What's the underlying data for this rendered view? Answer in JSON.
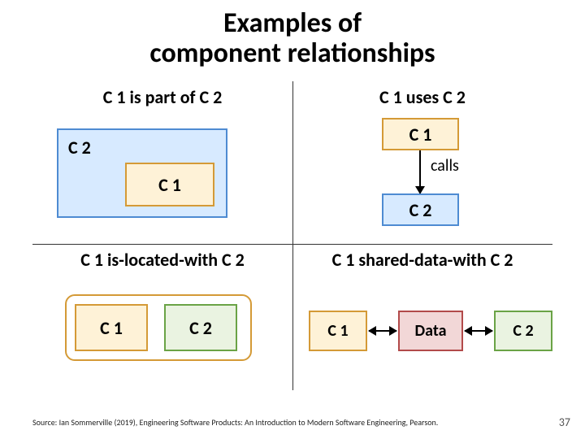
{
  "title_line1": "Examples of",
  "title_line2": "component relationships",
  "quadrants": {
    "tl": {
      "title": "C 1 is part of C 2",
      "outer": "C 2",
      "inner": "C 1"
    },
    "tr": {
      "title": "C 1 uses C 2",
      "c1": "C 1",
      "c2": "C 2",
      "edge": "calls"
    },
    "bl": {
      "title": "C 1 is-located-with C 2",
      "c1": "C 1",
      "c2": "C 2"
    },
    "br": {
      "title": "C 1 shared-data-with C 2",
      "c1": "C 1",
      "data": "Data",
      "c2": "C 2"
    }
  },
  "footer": "Source: Ian Sommerville (2019), Engineering Software Products: An Introduction to Modern Software Engineering, Pearson.",
  "page": "37"
}
